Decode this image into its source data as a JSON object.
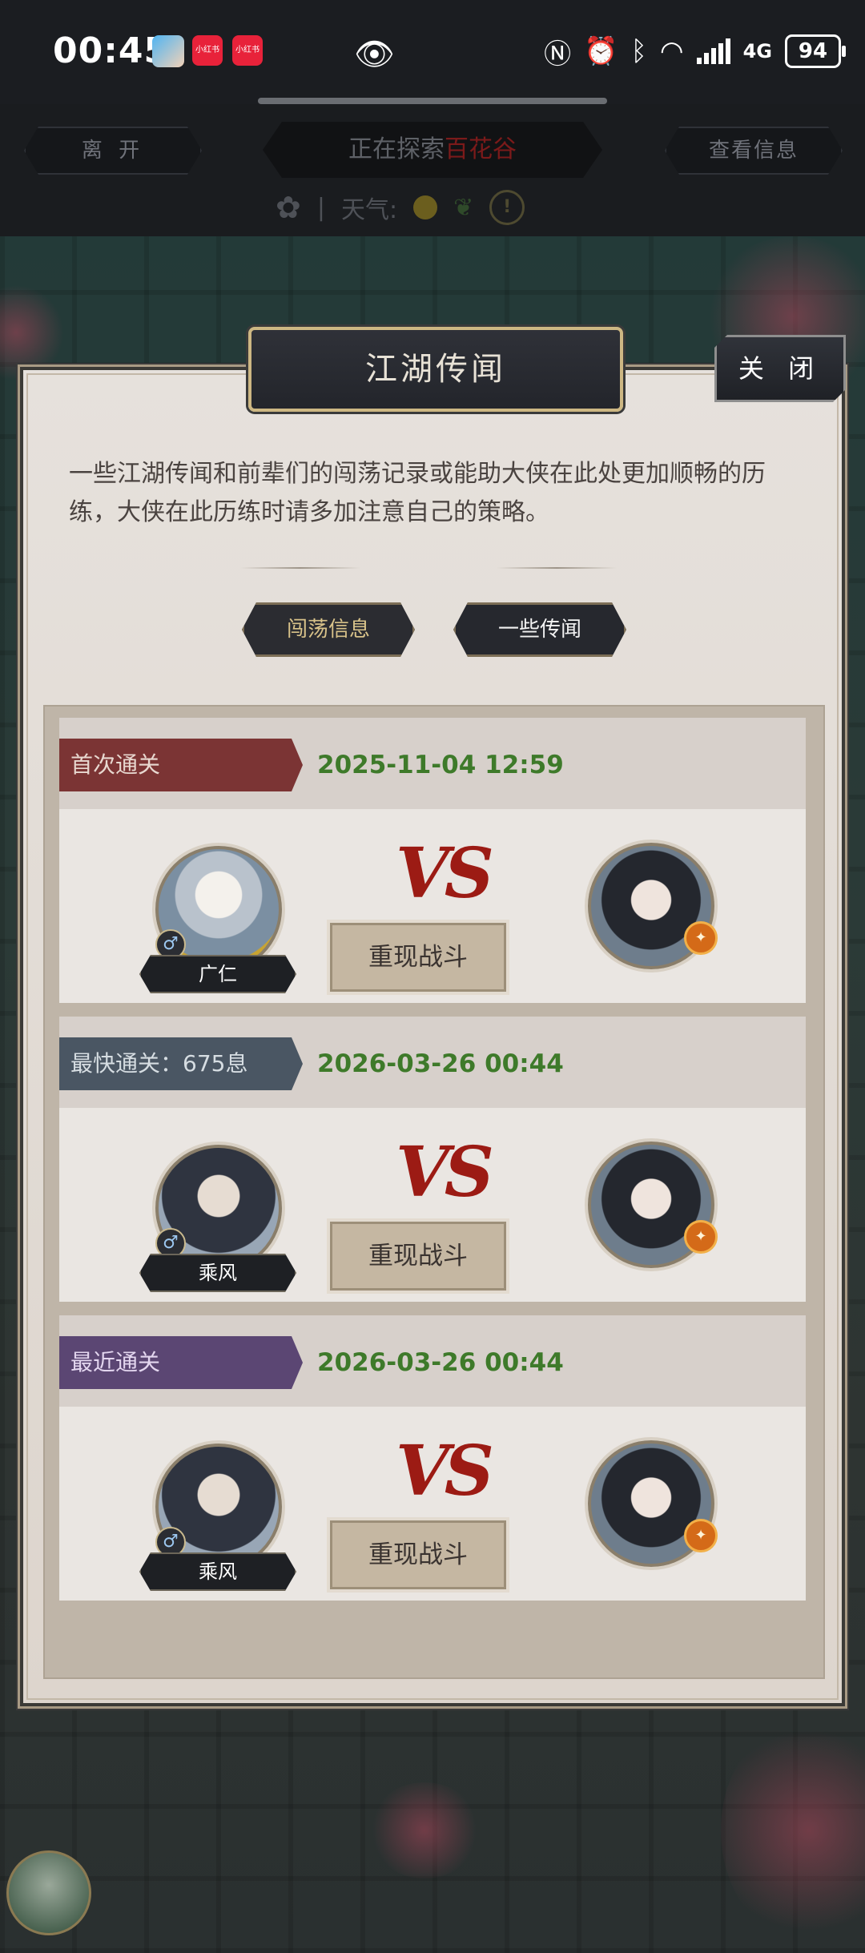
{
  "status_bar": {
    "time": "00:45",
    "notif_apps": [
      "小红书",
      "小红书"
    ],
    "icons": [
      "nfc-icon",
      "alarm-icon",
      "bluetooth-icon",
      "wifi-icon",
      "signal-icon",
      "4g-icon"
    ],
    "network_label": "4G",
    "battery": "94"
  },
  "top_bar": {
    "leave_label": "离 开",
    "exploring_prefix": "正在探索",
    "exploring_place": "百花谷",
    "view_info_label": "查看信息",
    "weather_label": "天气:"
  },
  "dialog": {
    "title": "江湖传闻",
    "close_label": "关 闭",
    "intro": "一些江湖传闻和前辈们的闯荡记录或能助大侠在此处更加顺畅的历练，大侠在此历练时请多加注意自己的策略。",
    "tabs": [
      {
        "label": "闯荡信息",
        "active": true
      },
      {
        "label": "一些传闻",
        "active": false
      }
    ],
    "records": [
      {
        "badge": "首次通关",
        "date": "2025-11-04 12:59",
        "player_name": "广仁",
        "vs": "VS",
        "replay_label": "重现战斗"
      },
      {
        "badge": "最快通关：675息",
        "date": "2026-03-26 00:44",
        "player_name": "乘风",
        "vs": "VS",
        "replay_label": "重现战斗"
      },
      {
        "badge": "最近通关",
        "date": "2026-03-26 00:44",
        "player_name": "乘风",
        "vs": "VS",
        "replay_label": "重现战斗"
      }
    ]
  },
  "colors": {
    "dialog_bg": "#e6e1dc",
    "date_green": "#3e7a2a",
    "first_badge": "#7b3434",
    "fast_badge": "#4a5663",
    "recent_badge": "#5b4673",
    "vs_red": "#9c1b14"
  }
}
